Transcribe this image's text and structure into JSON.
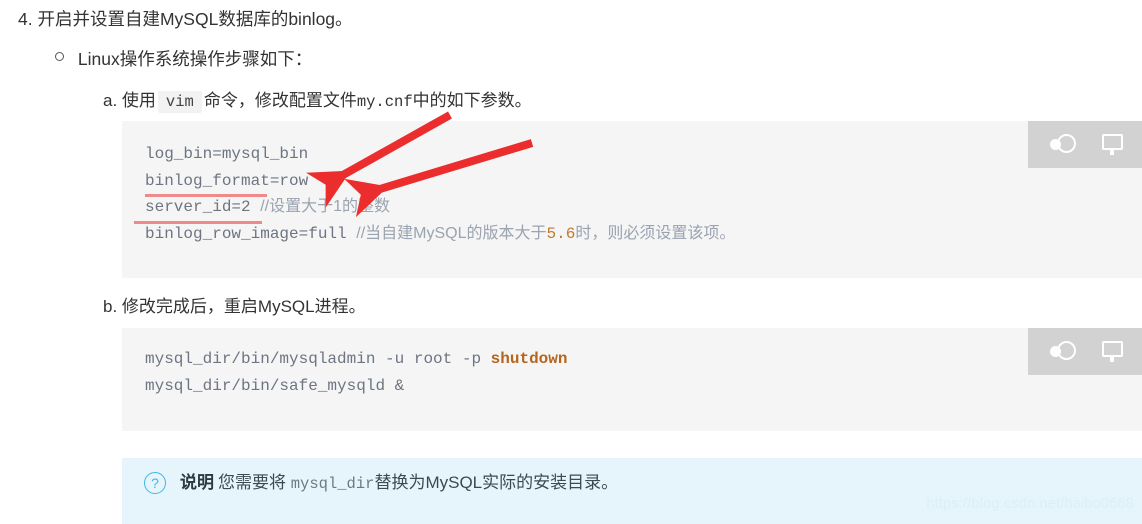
{
  "doc": {
    "item_4": {
      "marker": "4.",
      "text": "开启并设置自建MySQL数据库的binlog。"
    },
    "item_linux": {
      "text": "Linux操作系统操作步骤如下："
    },
    "item_a": {
      "marker": "a.",
      "prefix": "使用",
      "inline_code": "vim",
      "suffix_1": "命令，修改配置文件",
      "inline_mono": "my.cnf",
      "suffix_2": "中的如下参数。"
    },
    "item_b": {
      "marker": "b.",
      "text": "修改完成后，重启MySQL进程。"
    }
  },
  "code_block_1": {
    "lines": [
      {
        "code": "log_bin=mysql_bin",
        "comment": "",
        "comment_num": "",
        "comment_tail": ""
      },
      {
        "code": "binlog_format=row",
        "comment": "",
        "comment_num": "",
        "comment_tail": ""
      },
      {
        "code": "server_id=2",
        "comment": "//设置大于1的整数",
        "comment_num": "",
        "comment_tail": ""
      },
      {
        "code": "binlog_row_image=full",
        "comment": "//当自建MySQL的版本大于",
        "comment_num": "5.6",
        "comment_tail": "时，则必须设置该项。"
      }
    ],
    "toolbar": {
      "theme_icon": "theme-toggle-icon",
      "copy_icon": "copy-code-icon"
    },
    "annotations": {
      "underline_1_target": "binlog_format=row",
      "underline_2_target": "server_id=2",
      "arrow_1": "red-arrow",
      "arrow_2": "red-arrow",
      "arrow_color": "#ec2d2d"
    }
  },
  "code_block_2": {
    "lines": [
      {
        "code": "mysql_dir/bin/mysqladmin -u root -p ",
        "bold": "shutdown"
      },
      {
        "code": "mysql_dir/bin/safe_mysqld &",
        "bold": ""
      }
    ],
    "toolbar": {
      "theme_icon": "theme-toggle-icon",
      "copy_icon": "copy-code-icon"
    }
  },
  "note": {
    "icon": "question-circle-icon",
    "label": "说明",
    "text_before": "您需要将",
    "mono": "mysql_dir",
    "text_after": "替换为MySQL实际的安装目录。"
  },
  "watermark": {
    "text": "https://blog.csdn.net/haibo0668"
  },
  "colors": {
    "code_bg": "#f5f5f5",
    "toolbar_bg": "#d2d2d2",
    "note_bg": "#e5f5fb",
    "note_accent": "#3eb7e8",
    "annotation_red": "#ec2d2d",
    "underline_red": "#f08a8a",
    "highlight_orange": "#c07a2a"
  }
}
